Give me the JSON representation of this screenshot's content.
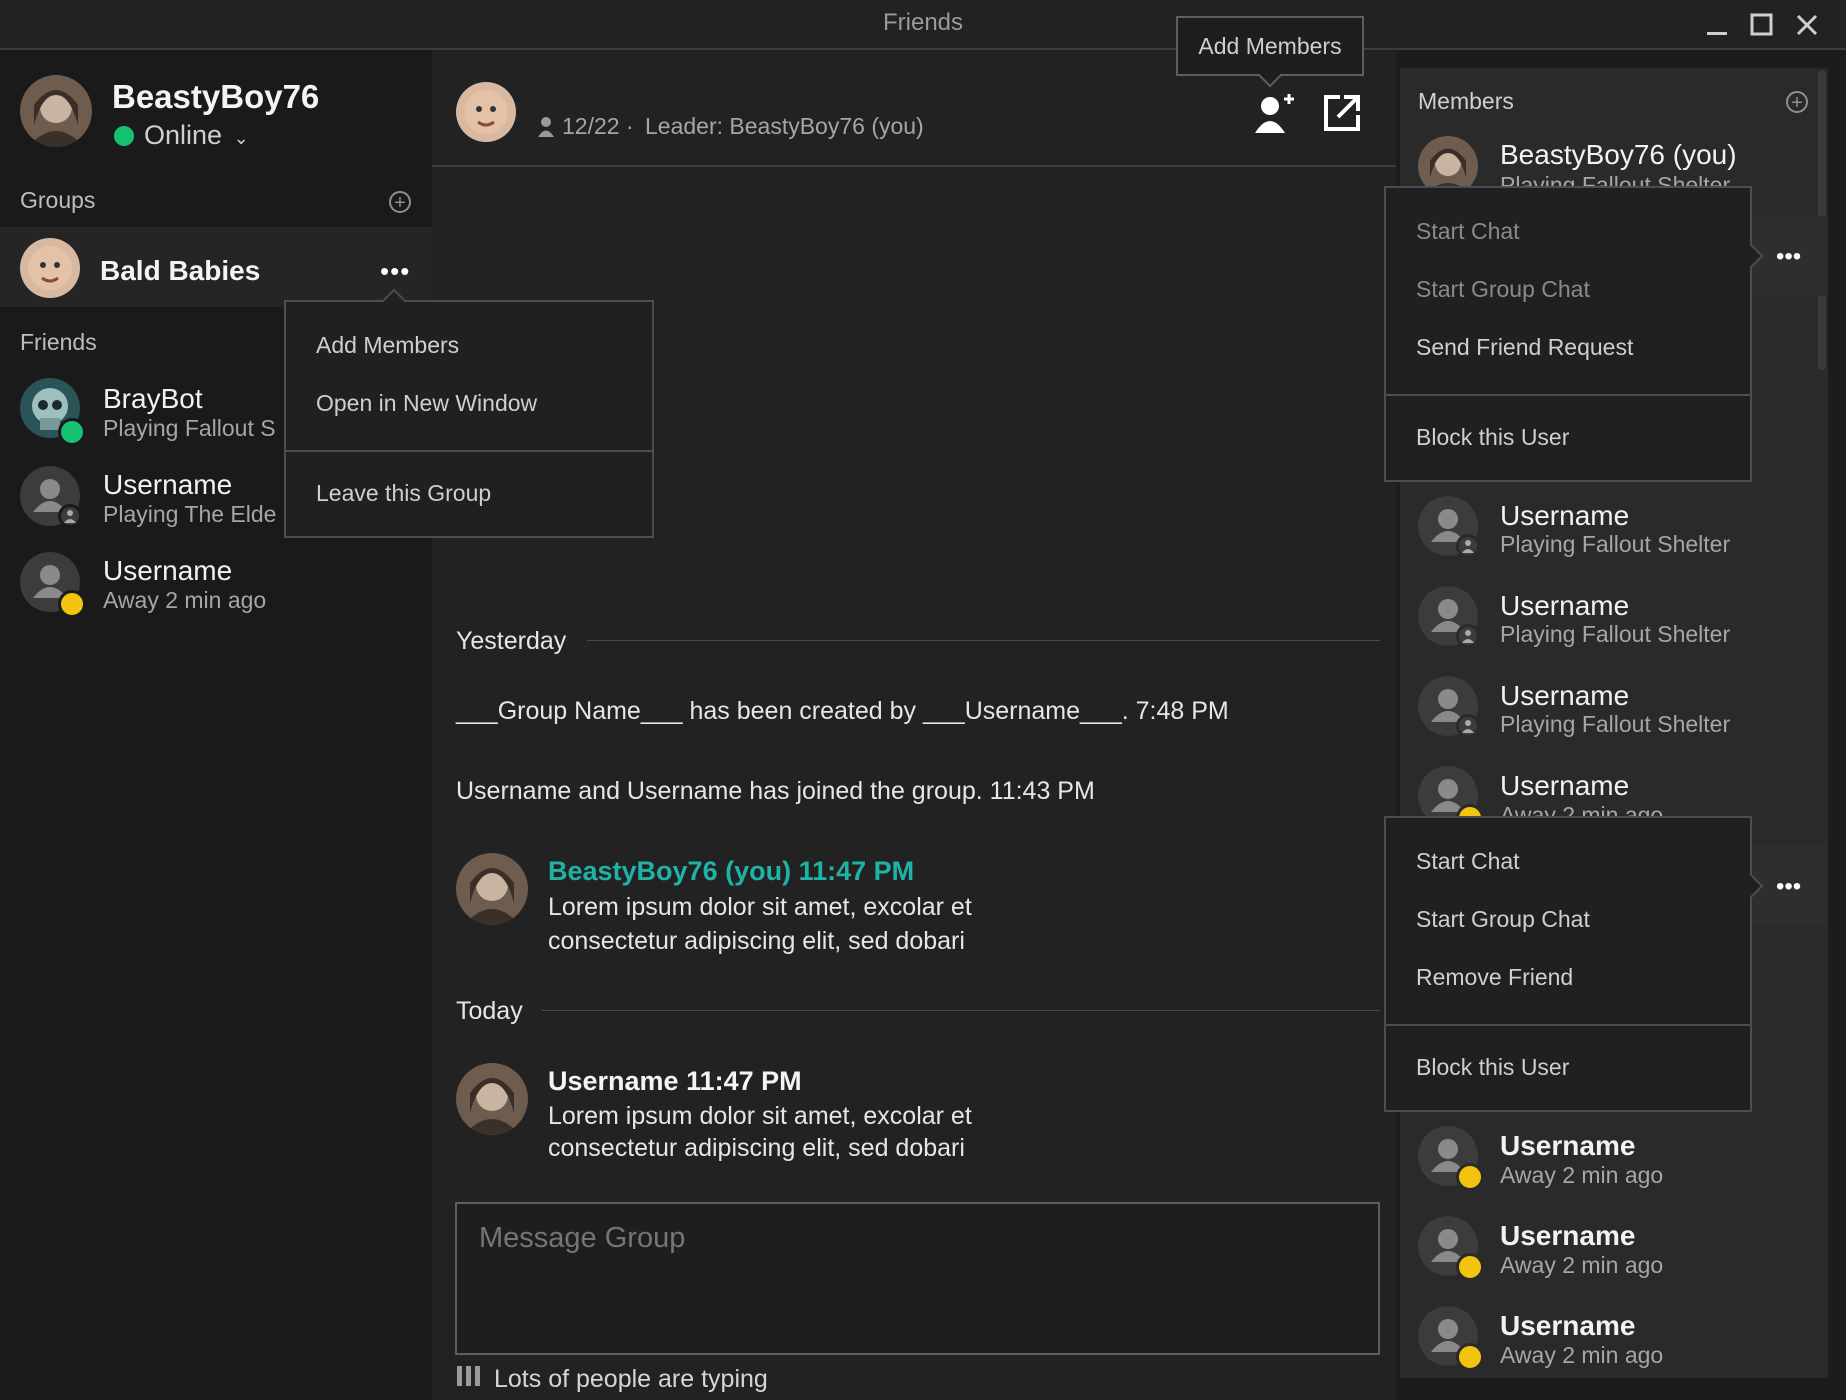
{
  "window": {
    "title": "Friends"
  },
  "profile": {
    "username": "BeastyBoy76",
    "status": "Online"
  },
  "groups": {
    "label": "Groups",
    "items": [
      {
        "name": "Bald Babies"
      }
    ]
  },
  "group_menu": {
    "items": [
      "Add Members",
      "Open in New Window"
    ],
    "danger": "Leave this Group"
  },
  "friends": {
    "label": "Friends",
    "items": [
      {
        "name": "BrayBot",
        "status": "Playing Fallout S",
        "state": "online"
      },
      {
        "name": "Username",
        "status": "Playing The Elde",
        "state": "offline"
      },
      {
        "name": "Username",
        "status": "Away 2 min ago",
        "state": "away"
      }
    ]
  },
  "chat_header": {
    "count": "12/22",
    "leader": "Leader: BeastyBoy76 (you)"
  },
  "tooltip": "Add Members",
  "chat": {
    "day_yesterday": "Yesterday",
    "system1": "___Group Name___ has been created by ___Username___.  7:48 PM",
    "system2": "Username and Username has joined the group. 11:43 PM",
    "msg1": {
      "author": "BeastyBoy76 (you) 11:47 PM",
      "line1": "Lorem ipsum dolor sit amet, excolar et",
      "line2": "consectetur adipiscing elit, sed dobari"
    },
    "day_today": "Today",
    "msg2": {
      "author": "Username 11:47 PM",
      "line1": "Lorem ipsum dolor sit amet, excolar et",
      "line2": "consectetur adipiscing elit, sed dobari"
    },
    "input_placeholder": "Message Group",
    "typing": "Lots of people are typing"
  },
  "members": {
    "label": "Members",
    "self": {
      "name": "BeastyBoy76 (you)",
      "status": "Playing Fallout Shelter"
    },
    "menu1": {
      "items": [
        "Start Chat",
        "Start Group Chat",
        "Send Friend Request"
      ],
      "danger": "Block this User"
    },
    "list_a": [
      {
        "name": "Username",
        "status": "Playing Fallout Shelter"
      },
      {
        "name": "Username",
        "status": "Playing Fallout Shelter"
      },
      {
        "name": "Username",
        "status": "Playing Fallout Shelter"
      }
    ],
    "partial": {
      "name": "Username",
      "status": "Away 2 min ago"
    },
    "menu2": {
      "items": [
        "Start Chat",
        "Start Group Chat",
        "Remove Friend"
      ],
      "danger": "Block this User"
    },
    "list_b": [
      {
        "name": "Username",
        "status": "Away 2 min ago"
      },
      {
        "name": "Username",
        "status": "Away 2 min ago"
      },
      {
        "name": "Username",
        "status": "Away 2 min ago"
      }
    ]
  },
  "colors": {
    "accent": "#1fb3a8",
    "online": "#16c172",
    "away": "#f2c40f",
    "panel": "#2a2a2a",
    "menu_border": "#4a4d55"
  }
}
